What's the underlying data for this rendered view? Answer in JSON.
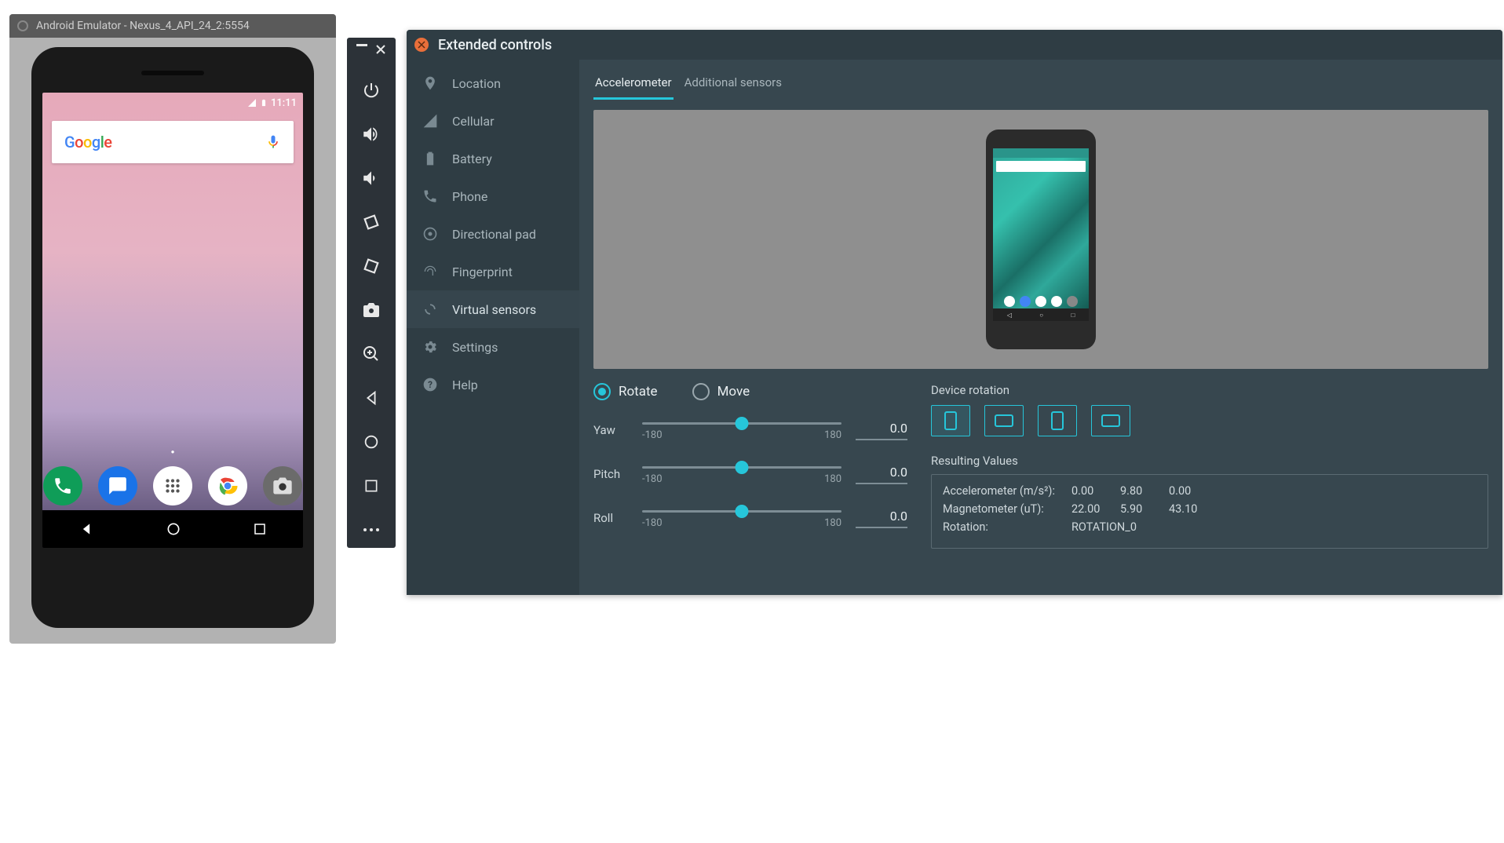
{
  "emulator": {
    "title": "Android Emulator - Nexus_4_API_24_2:5554",
    "status_time": "11:11",
    "search_placeholder": "Google"
  },
  "extended": {
    "title": "Extended controls",
    "sidebar": [
      {
        "label": "Location"
      },
      {
        "label": "Cellular"
      },
      {
        "label": "Battery"
      },
      {
        "label": "Phone"
      },
      {
        "label": "Directional pad"
      },
      {
        "label": "Fingerprint"
      },
      {
        "label": "Virtual sensors"
      },
      {
        "label": "Settings"
      },
      {
        "label": "Help"
      }
    ],
    "tabs": {
      "accel": "Accelerometer",
      "additional": "Additional sensors"
    },
    "mode": {
      "rotate": "Rotate",
      "move": "Move"
    },
    "sliders": {
      "yaw": {
        "label": "Yaw",
        "min": "-180",
        "max": "180",
        "value": "0.0"
      },
      "pitch": {
        "label": "Pitch",
        "min": "-180",
        "max": "180",
        "value": "0.0"
      },
      "roll": {
        "label": "Roll",
        "min": "-180",
        "max": "180",
        "value": "0.0"
      }
    },
    "device_rotation_label": "Device rotation",
    "resulting_label": "Resulting Values",
    "results": {
      "accel_label": "Accelerometer (m/s²):",
      "accel_x": "0.00",
      "accel_y": "9.80",
      "accel_z": "0.00",
      "mag_label": "Magnetometer (uT):",
      "mag_x": "22.00",
      "mag_y": "5.90",
      "mag_z": "43.10",
      "rot_label": "Rotation:",
      "rot_val": "ROTATION_0"
    }
  }
}
